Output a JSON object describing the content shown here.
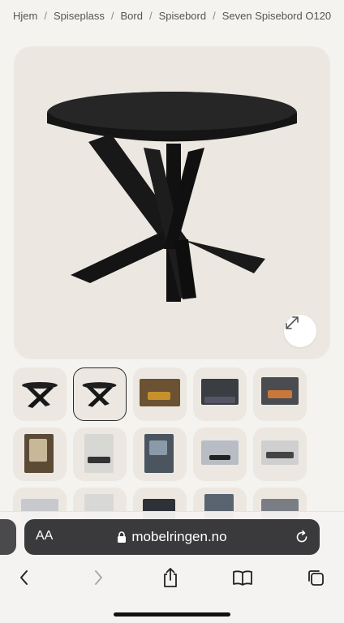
{
  "breadcrumb": {
    "items": [
      "Hjem",
      "Spiseplass",
      "Bord",
      "Spisebord",
      "Seven Spisebord O120"
    ],
    "separator": "/"
  },
  "product_image": {
    "alt": "Seven Spisebord O120",
    "expand_icon": "expand-arrows-icon"
  },
  "thumbnails": [
    {
      "kind": "table-black",
      "selected": false
    },
    {
      "kind": "table-black",
      "selected": true
    },
    {
      "kind": "room-warm",
      "selected": false
    },
    {
      "kind": "room-dark",
      "selected": false
    },
    {
      "kind": "room-orange-chairs",
      "selected": false
    },
    {
      "kind": "room-doorway",
      "selected": false
    },
    {
      "kind": "room-light",
      "selected": false
    },
    {
      "kind": "room-blue",
      "selected": false
    },
    {
      "kind": "room-grey",
      "selected": false
    },
    {
      "kind": "room-kitchen",
      "selected": false
    },
    {
      "kind": "room-partial",
      "selected": false
    },
    {
      "kind": "room-partial",
      "selected": false
    },
    {
      "kind": "room-partial",
      "selected": false
    },
    {
      "kind": "room-partial",
      "selected": false
    },
    {
      "kind": "room-partial",
      "selected": false
    }
  ],
  "browser": {
    "text_size_label": "AA",
    "url": "mobelringen.no",
    "lock_icon": "lock-icon",
    "reload_icon": "reload-icon",
    "toolbar": [
      "back-icon",
      "forward-icon",
      "share-icon",
      "bookmarks-icon",
      "tabs-icon"
    ]
  },
  "colors": {
    "page_bg": "#f5f3f0",
    "image_bg": "#ece8e1",
    "address_bar": "#3a3a3c",
    "table": "#1c1c1c"
  }
}
